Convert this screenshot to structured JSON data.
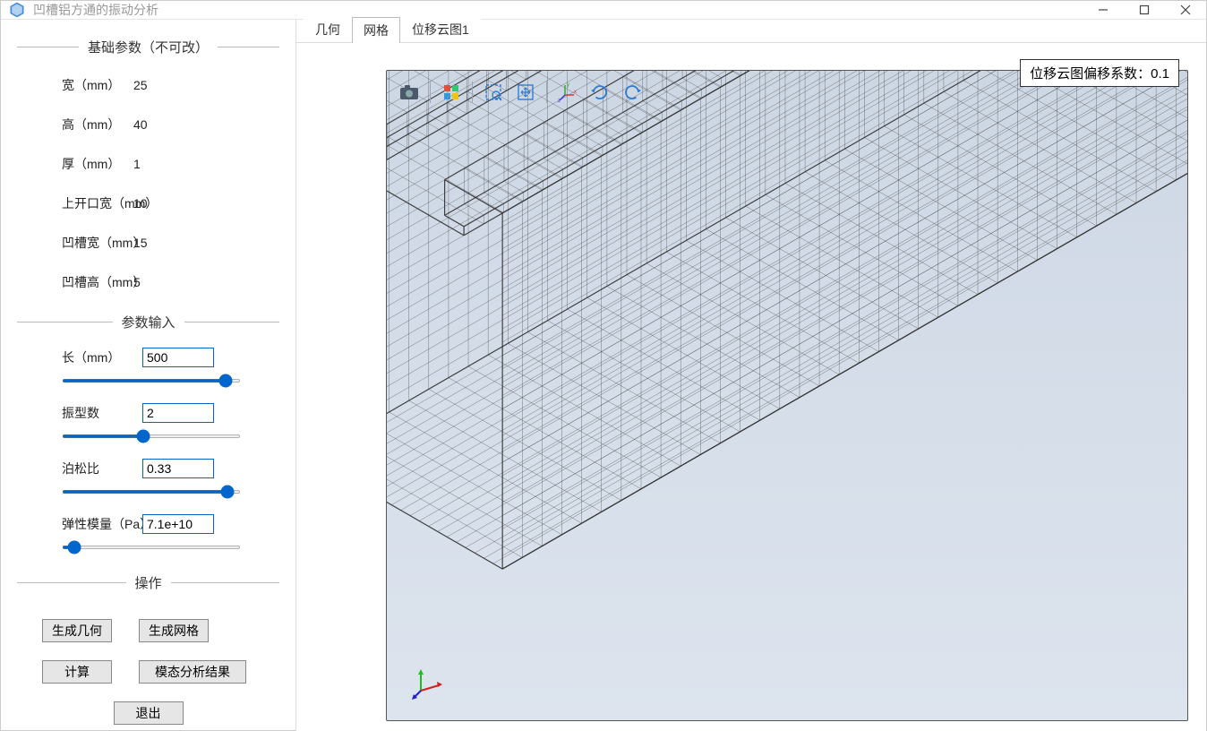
{
  "window": {
    "title": "凹槽铝方通的振动分析"
  },
  "sections": {
    "fixed": "基础参数（不可改）",
    "input": "参数输入",
    "ops": "操作"
  },
  "fixed_params": {
    "width": {
      "label": "宽（mm）",
      "value": "25"
    },
    "height": {
      "label": "高（mm）",
      "value": "40"
    },
    "thickness": {
      "label": "厚（mm）",
      "value": "1"
    },
    "top_open": {
      "label": "上开口宽（mm）",
      "value": "10"
    },
    "groove_w": {
      "label": "凹槽宽（mm）",
      "value": "15"
    },
    "groove_h": {
      "label": "凹槽高（mm）",
      "value": "5"
    }
  },
  "input_params": {
    "length": {
      "label": "长（mm）",
      "value": "500"
    },
    "modes": {
      "label": "振型数",
      "value": "2"
    },
    "poisson": {
      "label": "泊松比",
      "value": "0.33"
    },
    "young": {
      "label": "弹性模量（Pa）",
      "value": "7.1e+10"
    }
  },
  "buttons": {
    "gen_geo": "生成几何",
    "gen_mesh": "生成网格",
    "compute": "计算",
    "modal_result": "模态分析结果",
    "exit": "退出"
  },
  "tabs": {
    "geom": "几何",
    "mesh": "网格",
    "disp": "位移云图1"
  },
  "overlay": {
    "label": "位移云图偏移系数：",
    "value": "0.1"
  }
}
